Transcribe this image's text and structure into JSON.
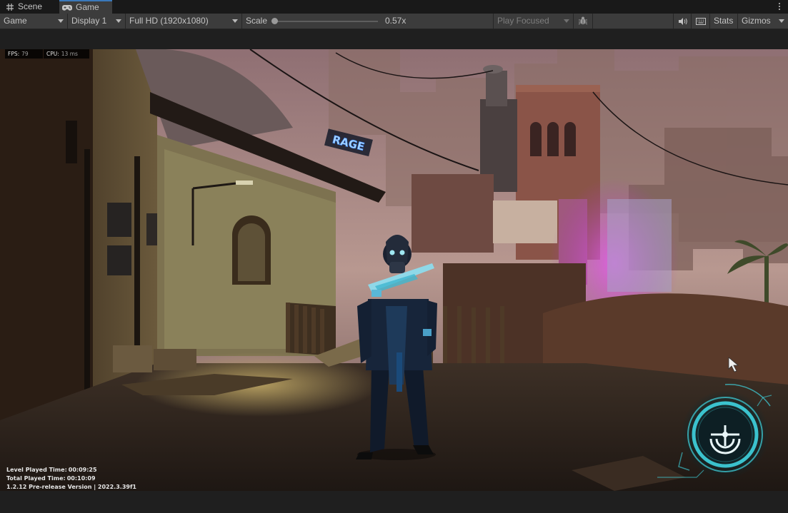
{
  "tabs": [
    {
      "label": "Scene",
      "icon": "grid-icon",
      "active": false
    },
    {
      "label": "Game",
      "icon": "gamepad-icon",
      "active": true
    }
  ],
  "toolbar": {
    "view_mode": "Game",
    "display": "Display 1",
    "resolution": "Full HD (1920x1080)",
    "scale_label": "Scale",
    "scale_value": "0.57x",
    "scale_fraction": 0.0,
    "play_mode": "Play Focused",
    "stats_label": "Stats",
    "gizmos_label": "Gizmos"
  },
  "overlay": {
    "fps_label": "FPS:",
    "fps_value": "79",
    "cpu_label": "CPU:",
    "cpu_value": "13 ms",
    "level_time_label": "Level Played Time:",
    "level_time_value": "00:09:25",
    "total_time_label": "Total Played Time:",
    "total_time_value": "00:10:09",
    "version_text": "1.2.12 Pre-release Version | 2022.3.39f1",
    "sign_text": "RAGE"
  },
  "colors": {
    "accent": "#3a79bb",
    "toolbar_bg": "#3c3c3c",
    "hud_cyan": "#3fd4e0",
    "neon_magenta": "#d24ed8"
  }
}
